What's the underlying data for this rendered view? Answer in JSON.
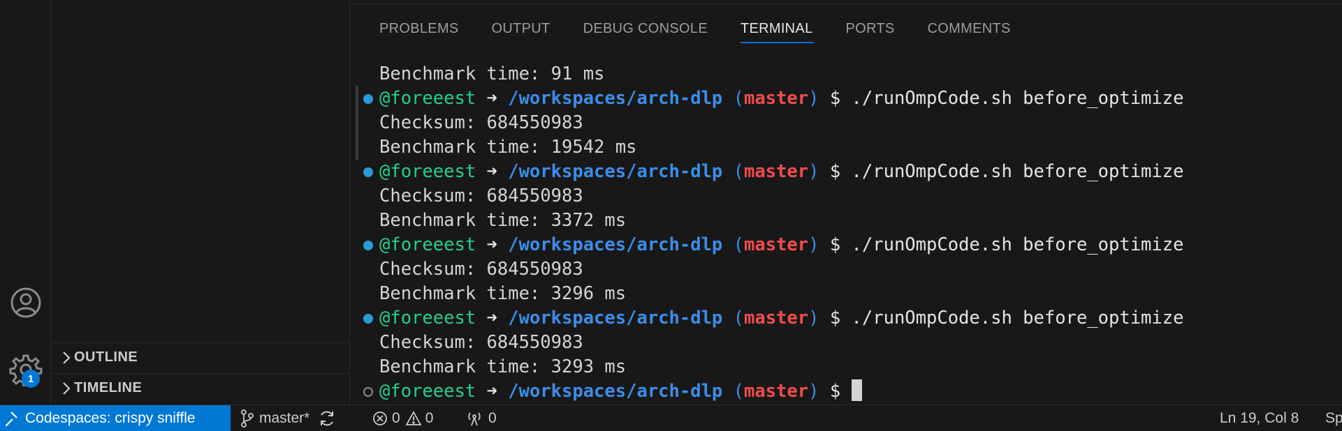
{
  "sidebar": {
    "sections": [
      {
        "title": "OUTLINE"
      },
      {
        "title": "TIMELINE"
      }
    ]
  },
  "activity_bar": {
    "icons": [
      "account-icon",
      "gear-icon"
    ],
    "settings_badge": "1"
  },
  "panel": {
    "tabs": [
      {
        "label": "PROBLEMS",
        "active": false
      },
      {
        "label": "OUTPUT",
        "active": false
      },
      {
        "label": "DEBUG CONSOLE",
        "active": false
      },
      {
        "label": "TERMINAL",
        "active": true
      },
      {
        "label": "PORTS",
        "active": false
      },
      {
        "label": "COMMENTS",
        "active": false
      }
    ]
  },
  "terminal": {
    "prompt": {
      "user": "@foreeest",
      "arrow": "➜",
      "path": "/workspaces/arch-dlp",
      "branch": "master",
      "symbol": "$"
    },
    "lines": [
      {
        "kind": "output",
        "text": "Benchmark time: 91 ms"
      },
      {
        "kind": "prompt",
        "status": "done",
        "command": "./runOmpCode.sh before_optimize"
      },
      {
        "kind": "output",
        "text": "Checksum: 684550983"
      },
      {
        "kind": "output",
        "text": "Benchmark time: 19542 ms"
      },
      {
        "kind": "prompt",
        "status": "done",
        "command": "./runOmpCode.sh before_optimize"
      },
      {
        "kind": "output",
        "text": "Checksum: 684550983"
      },
      {
        "kind": "output",
        "text": "Benchmark time: 3372 ms"
      },
      {
        "kind": "prompt",
        "status": "done",
        "command": "./runOmpCode.sh before_optimize"
      },
      {
        "kind": "output",
        "text": "Checksum: 684550983"
      },
      {
        "kind": "output",
        "text": "Benchmark time: 3296 ms"
      },
      {
        "kind": "prompt",
        "status": "done",
        "command": "./runOmpCode.sh before_optimize"
      },
      {
        "kind": "output",
        "text": "Checksum: 684550983"
      },
      {
        "kind": "output",
        "text": "Benchmark time: 3293 ms"
      },
      {
        "kind": "prompt",
        "status": "open",
        "command": ""
      }
    ]
  },
  "statusbar": {
    "remote_label": "Codespaces: crispy sniffle",
    "branch": "master*",
    "errors": "0",
    "warnings": "0",
    "ports": "0",
    "position": "Ln 19, Col 8",
    "spaces": "Sp"
  },
  "colors": {
    "accent": "#0078d4",
    "user": "#23d18b",
    "path": "#3b8eea",
    "branch": "#f14c4c"
  }
}
